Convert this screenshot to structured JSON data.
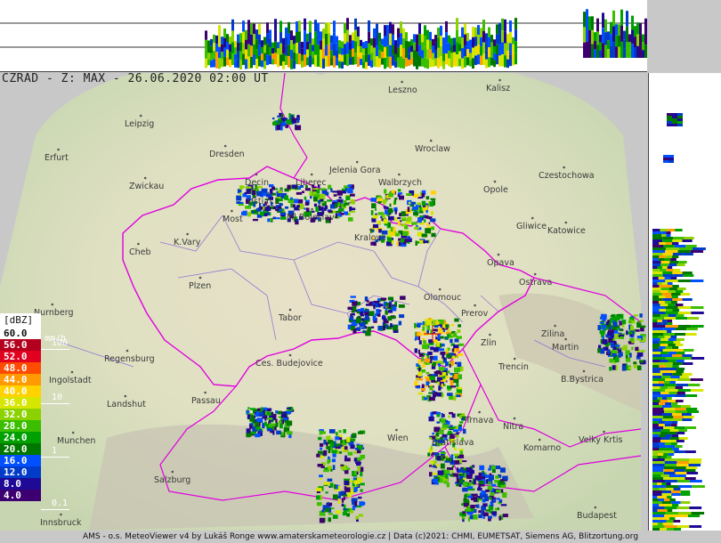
{
  "title": "CZRAD - Z: MAX - 26.06.2020 02:00 UT",
  "legend": {
    "unit": "[dBZ]",
    "rate_unit": "mm/h",
    "rows": [
      {
        "label": "60.0",
        "color": "#ffffff",
        "text_color": "#111111"
      },
      {
        "label": "56.0",
        "color": "#b4001e",
        "text_color": "#ffffff"
      },
      {
        "label": "52.0",
        "color": "#e1001e",
        "text_color": "#ffffff"
      },
      {
        "label": "48.0",
        "color": "#ff4b00",
        "text_color": "#ffffff"
      },
      {
        "label": "44.0",
        "color": "#ff9b00",
        "text_color": "#ffffff"
      },
      {
        "label": "40.0",
        "color": "#ffd200",
        "text_color": "#ffffff"
      },
      {
        "label": "36.0",
        "color": "#d6e600",
        "text_color": "#ffffff"
      },
      {
        "label": "32.0",
        "color": "#8cd200",
        "text_color": "#ffffff"
      },
      {
        "label": "28.0",
        "color": "#3cbe00",
        "text_color": "#ffffff"
      },
      {
        "label": "24.0",
        "color": "#00a000",
        "text_color": "#ffffff"
      },
      {
        "label": "20.0",
        "color": "#007800",
        "text_color": "#ffffff"
      },
      {
        "label": "16.0",
        "color": "#0050ff",
        "text_color": "#ffffff"
      },
      {
        "label": "12.0",
        "color": "#003cc8",
        "text_color": "#ffffff"
      },
      {
        "label": "8.0",
        "color": "#1e0a96",
        "text_color": "#ffffff"
      },
      {
        "label": "4.0",
        "color": "#3c0070",
        "text_color": "#ffffff"
      }
    ],
    "rates": [
      "100",
      "10",
      "1",
      "0.1"
    ]
  },
  "cities": [
    "Leszno",
    "Kalisz",
    "Leipzig",
    "Wroclaw",
    "Erfurt",
    "Dresden",
    "Jelenia Gora",
    "Czestochowa",
    "Zwickau",
    "Walbrzych",
    "Opole",
    "Decin",
    "Liberec",
    "Usti n.L.",
    "Gliwice",
    "Katowice",
    "Ml.Boleslav",
    "Most",
    "Cheb",
    "K.Vary",
    "Kralove",
    "Opava",
    "Ostrava",
    "Plzen",
    "Olomouc",
    "Prerov",
    "Nurnberg",
    "Tabor",
    "Zlin",
    "Zilina",
    "Martin",
    "Regensburg",
    "Ces. Budejovice",
    "Trencin",
    "B.Bystrica",
    "Ingolstadt",
    "Passau",
    "Landshut",
    "Trnava",
    "Nitra",
    "Munchen",
    "Wien",
    "Bratislava",
    "Velky Krtis",
    "Komarno",
    "Salzburg",
    "Budapest",
    "Innsbruck"
  ],
  "footer": "AMS - o.s. MeteoViewer v4 by Lukáš Ronge www.amaterskameteorologie.cz | Data (c)2021: CHMI, EUMETSAT, Siemens AG, Blitzortung.org",
  "colors": {
    "border_country": "#e000e0",
    "border_region": "#8c6cd8",
    "background": "#c8c8c8",
    "profile_bg": "#ffffff"
  }
}
